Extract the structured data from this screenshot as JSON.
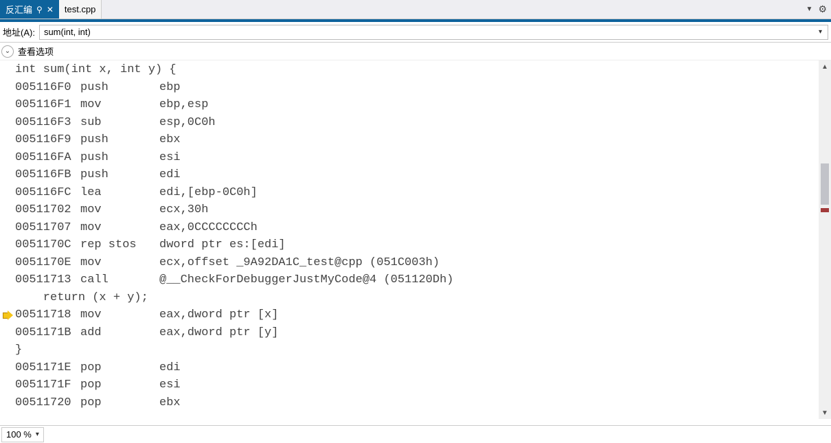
{
  "tabs": {
    "disassembly_label": "反汇编",
    "file_label": "test.cpp"
  },
  "address_row": {
    "label": "地址(A):",
    "value": "sum(int, int)"
  },
  "options_row": {
    "label": "查看选项"
  },
  "code_lines": [
    {
      "type": "src",
      "text": "int sum(int x, int y) {",
      "ip": false
    },
    {
      "type": "asm",
      "addr": "005116F0",
      "mnem": "push",
      "ops": "ebp",
      "ip": false
    },
    {
      "type": "asm",
      "addr": "005116F1",
      "mnem": "mov",
      "ops": "ebp,esp",
      "ip": false
    },
    {
      "type": "asm",
      "addr": "005116F3",
      "mnem": "sub",
      "ops": "esp,0C0h",
      "ip": false
    },
    {
      "type": "asm",
      "addr": "005116F9",
      "mnem": "push",
      "ops": "ebx",
      "ip": false
    },
    {
      "type": "asm",
      "addr": "005116FA",
      "mnem": "push",
      "ops": "esi",
      "ip": false
    },
    {
      "type": "asm",
      "addr": "005116FB",
      "mnem": "push",
      "ops": "edi",
      "ip": false
    },
    {
      "type": "asm",
      "addr": "005116FC",
      "mnem": "lea",
      "ops": "edi,[ebp-0C0h]",
      "ip": false
    },
    {
      "type": "asm",
      "addr": "00511702",
      "mnem": "mov",
      "ops": "ecx,30h",
      "ip": false
    },
    {
      "type": "asm",
      "addr": "00511707",
      "mnem": "mov",
      "ops": "eax,0CCCCCCCCh",
      "ip": false
    },
    {
      "type": "asm",
      "addr": "0051170C",
      "mnem": "rep stos",
      "ops": "dword ptr es:[edi]",
      "ip": false
    },
    {
      "type": "asm",
      "addr": "0051170E",
      "mnem": "mov",
      "ops": "ecx,offset _9A92DA1C_test@cpp (051C003h)",
      "ip": false
    },
    {
      "type": "asm",
      "addr": "00511713",
      "mnem": "call",
      "ops": "@__CheckForDebuggerJustMyCode@4 (051120Dh)",
      "ip": false
    },
    {
      "type": "src",
      "text": "    return (x + y);",
      "ip": false
    },
    {
      "type": "asm",
      "addr": "00511718",
      "mnem": "mov",
      "ops": "eax,dword ptr [x]",
      "ip": true
    },
    {
      "type": "asm",
      "addr": "0051171B",
      "mnem": "add",
      "ops": "eax,dword ptr [y]",
      "ip": false
    },
    {
      "type": "src",
      "text": "}",
      "ip": false
    },
    {
      "type": "asm",
      "addr": "0051171E",
      "mnem": "pop",
      "ops": "edi",
      "ip": false
    },
    {
      "type": "asm",
      "addr": "0051171F",
      "mnem": "pop",
      "ops": "esi",
      "ip": false
    },
    {
      "type": "asm",
      "addr": "00511720",
      "mnem": "pop",
      "ops": "ebx",
      "ip": false
    }
  ],
  "status": {
    "zoom": "100 %"
  }
}
